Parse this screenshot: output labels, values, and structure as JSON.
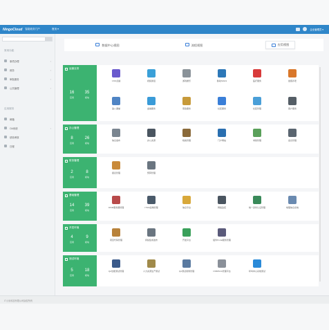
{
  "header": {
    "logo_text": "NingoCloud",
    "system_name": "智能政务门户",
    "nav_label": "首页 ▾",
    "user_label": "企业管理员 ▾"
  },
  "sidebar": {
    "groups": [
      {
        "label": "常用功能",
        "items": [
          {
            "label": "事项办理",
            "has_children": true
          },
          {
            "label": "政务",
            "has_children": true
          },
          {
            "label": "审批服务",
            "has_children": true
          },
          {
            "label": "公共管理",
            "has_children": true
          }
        ]
      },
      {
        "label": "应用服务",
        "items": [
          {
            "label": "邮箱",
            "has_children": false
          },
          {
            "label": "OA系统",
            "has_children": true
          },
          {
            "label": "绩效考核",
            "has_children": false
          },
          {
            "label": "日程",
            "has_children": false
          }
        ]
      }
    ]
  },
  "tabs": [
    {
      "label": "数据中心视图",
      "icon": "monitor-icon",
      "active": false
    },
    {
      "label": "流程视图",
      "icon": "share-icon",
      "active": false
    },
    {
      "label": "应用视图",
      "icon": "grid-icon",
      "active": true
    }
  ],
  "sections": [
    {
      "title": "运营业务",
      "stats": [
        {
          "value": "16",
          "label": "应用"
        },
        {
          "value": "35",
          "label": "模块"
        }
      ],
      "apps": [
        {
          "name": "VOD点播",
          "icon": "video-icon",
          "color": "#6a5acd"
        },
        {
          "name": "视频通话",
          "icon": "chat-icon",
          "color": "#3aa0d8"
        },
        {
          "name": "游戏娱乐",
          "icon": "gamepad-icon",
          "color": "#8a9299"
        },
        {
          "name": "移动SDGS",
          "icon": "network-icon",
          "color": "#2d78b8"
        },
        {
          "name": "医疗服务",
          "icon": "medical-icon",
          "color": "#d83a3a"
        },
        {
          "name": "健康养老",
          "icon": "person-icon",
          "color": "#d9772a"
        },
        {
          "name": "第八课堂",
          "icon": "people-icon",
          "color": "#4f84c4"
        },
        {
          "name": "金融服务",
          "icon": "finance-icon",
          "color": "#3a9bd8"
        },
        {
          "name": "家政服务",
          "icon": "tools-icon",
          "color": "#c79a3a"
        },
        {
          "name": "社区服务",
          "icon": "community-icon",
          "color": "#3a7fd8"
        },
        {
          "name": "社区管理",
          "icon": "manage-icon",
          "color": "#4a9fd8"
        },
        {
          "name": "客户服务",
          "icon": "service-icon",
          "color": "#555e66"
        }
      ]
    },
    {
      "title": "办公管理",
      "stats": [
        {
          "value": "8",
          "label": "应用"
        },
        {
          "value": "26",
          "label": "模块"
        }
      ],
      "apps": [
        {
          "name": "信息发布",
          "icon": "laptop-icon",
          "color": "#7a8590"
        },
        {
          "name": "办公资源",
          "icon": "desktop-icon",
          "color": "#4a5560"
        },
        {
          "name": "档案管理",
          "icon": "archive-icon",
          "color": "#8a6a3a"
        },
        {
          "name": "门户网站",
          "icon": "monitor-icon",
          "color": "#2a6fb0"
        },
        {
          "name": "考勤管理",
          "icon": "clock-icon",
          "color": "#5aa05a"
        },
        {
          "name": "会议管理",
          "icon": "meeting-icon",
          "color": "#5a6570"
        }
      ]
    },
    {
      "title": "财务管理",
      "stats": [
        {
          "value": "2",
          "label": "应用"
        },
        {
          "value": "8",
          "label": "模块"
        }
      ],
      "apps": [
        {
          "name": "报表管理",
          "icon": "chart-icon",
          "color": "#c98a3a"
        },
        {
          "name": "预算管理",
          "icon": "printer-icon",
          "color": "#6a7580"
        }
      ]
    },
    {
      "title": "基础管理",
      "stats": [
        {
          "value": "14",
          "label": "应用"
        },
        {
          "value": "39",
          "label": "模块"
        }
      ],
      "apps": [
        {
          "name": "IDSM服务器管理",
          "icon": "server-icon",
          "color": "#b84a4a"
        },
        {
          "name": "ITSM运维管理",
          "icon": "rack-icon",
          "color": "#4a5a6a"
        },
        {
          "name": "信息平台",
          "icon": "folder-icon",
          "color": "#d8a83a"
        },
        {
          "name": "网络监控",
          "icon": "monitor-wave-icon",
          "color": "#4a5560"
        },
        {
          "name": "统一身份认证管理",
          "icon": "id-icon",
          "color": "#3a8a5a"
        },
        {
          "name": "地理信息系统",
          "icon": "gis-icon",
          "color": "#6a8ab0"
        }
      ]
    },
    {
      "title": "开发环境",
      "stats": [
        {
          "value": "4",
          "label": "应用"
        },
        {
          "value": "9",
          "label": "模块"
        }
      ],
      "apps": [
        {
          "name": "项目代码管理",
          "icon": "code-icon",
          "color": "#b8823a"
        },
        {
          "name": "持续集成发布",
          "icon": "graph-icon",
          "color": "#6a7580"
        },
        {
          "name": "开发平台",
          "icon": "dev-icon",
          "color": "#3aa05a"
        },
        {
          "name": "组件Portal服务管理",
          "icon": "cube-icon",
          "color": "#5a5a7a"
        }
      ]
    },
    {
      "title": "测试环境",
      "stats": [
        {
          "value": "5",
          "label": "应用"
        },
        {
          "value": "18",
          "label": "模块"
        }
      ],
      "apps": [
        {
          "name": "QA性能测试管理",
          "icon": "gauge-icon",
          "color": "#3a5a8a"
        },
        {
          "name": "人力资源生产测试",
          "icon": "hammer-icon",
          "color": "#a08a4a"
        },
        {
          "name": "QA测试用例管理",
          "icon": "building-icon",
          "color": "#5a7aa0"
        },
        {
          "name": "OSB/SOA管理平台",
          "icon": "cylinder-icon",
          "color": "#8a9099"
        },
        {
          "name": "呼叫中心系统测试",
          "icon": "phone-icon",
          "color": "#2a8ad8"
        }
      ]
    }
  ],
  "footer": {
    "text": "IT小米科技有限公司版权所有"
  }
}
